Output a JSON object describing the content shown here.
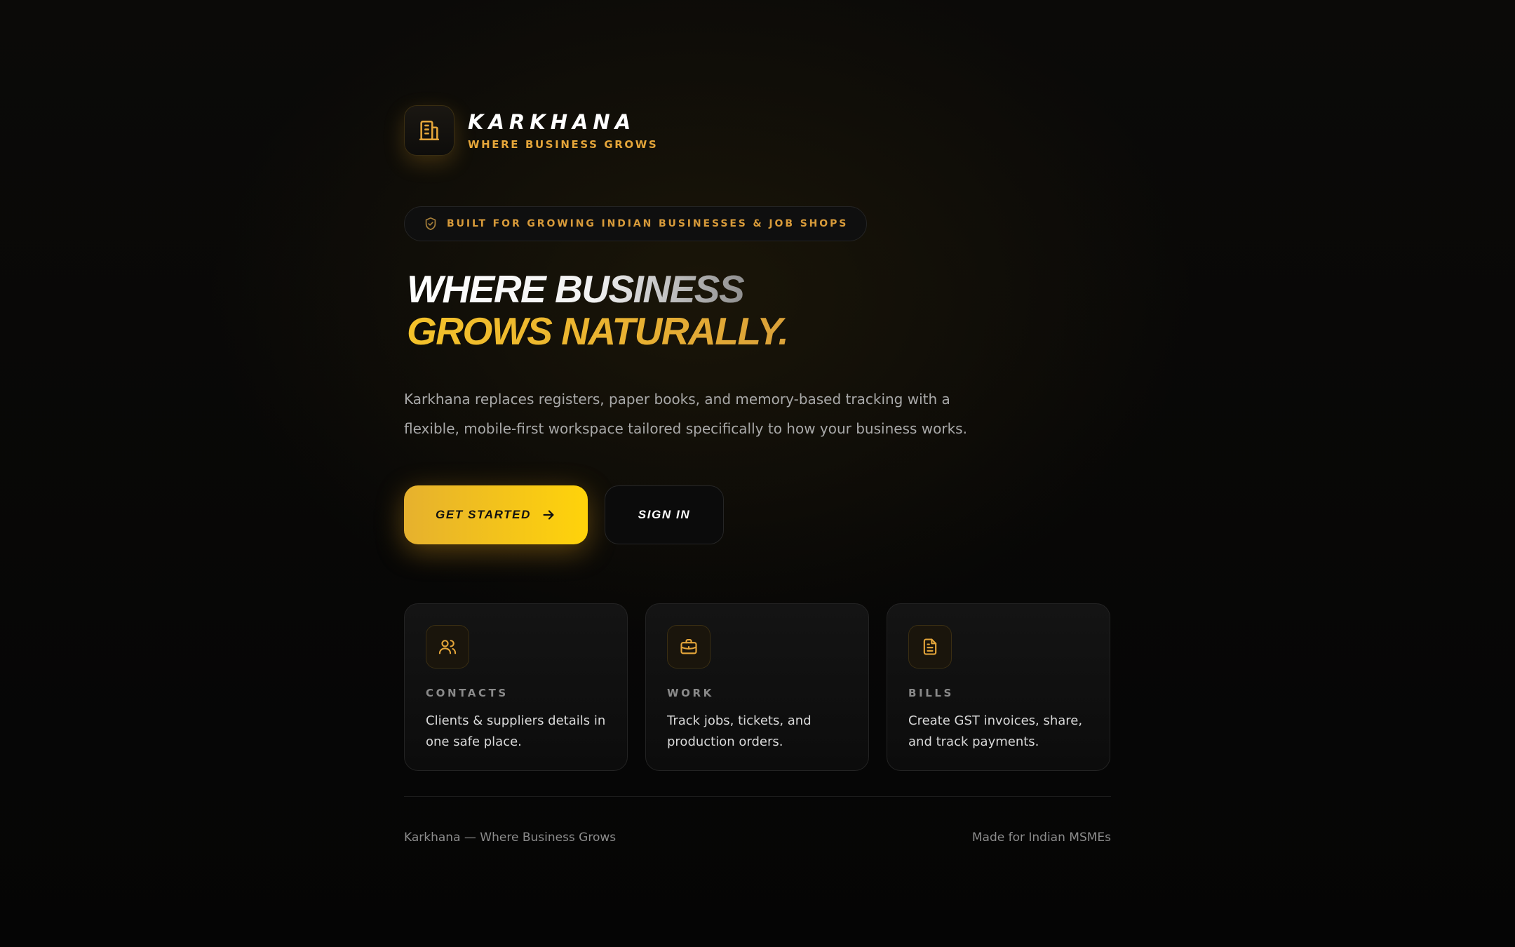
{
  "brand": {
    "name": "KARKHANA",
    "tagline": "WHERE BUSINESS GROWS",
    "logo_icon": "building-icon",
    "accent": "#e5a63a"
  },
  "badge": {
    "icon": "shield-check-icon",
    "text": "BUILT FOR GROWING INDIAN BUSINESSES & JOB SHOPS"
  },
  "hero": {
    "line1": "WHERE BUSINESS",
    "line2": "GROWS NATURALLY.",
    "description": "Karkhana replaces registers, paper books, and memory-based tracking with a flexible, mobile-first workspace tailored specifically to how your business works."
  },
  "cta": {
    "primary_label": "GET STARTED",
    "primary_icon": "arrow-right-icon",
    "secondary_label": "SIGN IN"
  },
  "features": [
    {
      "icon": "users-icon",
      "title": "CONTACTS",
      "description": "Clients & suppliers details in one safe place."
    },
    {
      "icon": "briefcase-icon",
      "title": "WORK",
      "description": "Track jobs, tickets, and production orders."
    },
    {
      "icon": "file-text-icon",
      "title": "BILLS",
      "description": "Create GST invoices, share, and track payments."
    }
  ],
  "footer": {
    "left": "Karkhana — Where Business Grows",
    "right": "Made for Indian MSMEs"
  }
}
